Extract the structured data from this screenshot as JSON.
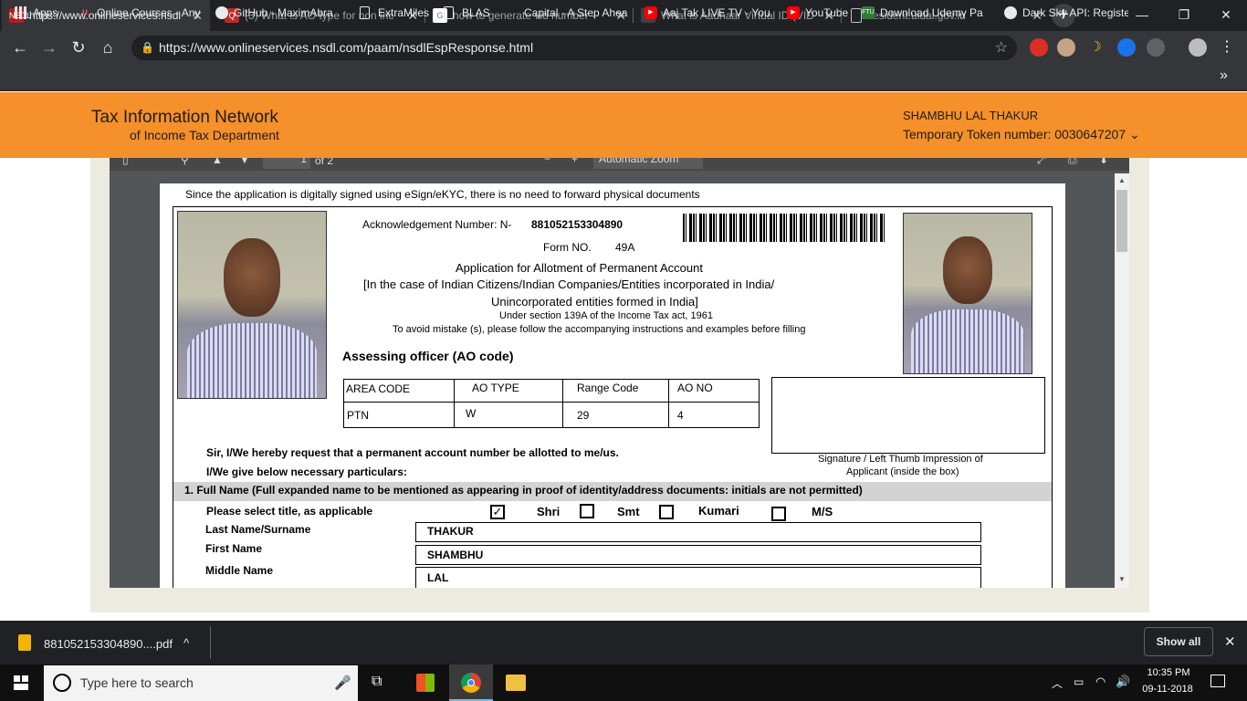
{
  "browser": {
    "tabs": [
      {
        "label": "https://www.onlineservices.nsdl",
        "favicon": "nsdl-icon",
        "favicon_text": "NSDL",
        "active": true
      },
      {
        "label": "(3) What is AO type for non inc",
        "favicon": "quora-icon",
        "favicon_text": "Q"
      },
      {
        "label": "how to generate vid number - ",
        "favicon": "google-icon",
        "favicon_text": "G"
      },
      {
        "label": "What is Aadhaar Virtual ID (VID",
        "favicon": "globe-icon",
        "favicon_text": "◐"
      },
      {
        "label": "resident.uidai.gov.in",
        "favicon": "page-icon",
        "favicon_text": ""
      }
    ],
    "new_tab_glyph": "+",
    "close_glyph": "✕",
    "window_controls": [
      "—",
      "❐",
      "✕"
    ],
    "nav": {
      "back": "←",
      "forward": "→",
      "reload": "↻",
      "home": "⌂"
    },
    "url": "https://www.onlineservices.nsdl.com/paam/nsdlEspResponse.html",
    "lock_glyph": "🔒",
    "star_glyph": "☆",
    "bookmarks": [
      {
        "label": "Apps",
        "icon": "apps-grid-icon"
      },
      {
        "label": "Online Courses - Any",
        "icon": "udemy-icon"
      },
      {
        "label": "GitHub - MaximAbra",
        "icon": "github-icon"
      },
      {
        "label": "ExtraMiles",
        "icon": "page-icon"
      },
      {
        "label": "BLAS",
        "icon": "page-icon"
      },
      {
        "label": "Capital - A Step Ahea",
        "icon": "none"
      },
      {
        "label": "Aaj Tak LIVE TV - You",
        "icon": "youtube-icon"
      },
      {
        "label": "YouTube",
        "icon": "youtube-icon"
      },
      {
        "label": "Download Udemy Pa",
        "icon": "ftu-icon"
      },
      {
        "label": "Dark Sky API: Registe",
        "icon": "darksky-icon"
      }
    ],
    "bookmarks_more": "»"
  },
  "site_header": {
    "brand_line1": "Tax Information Network",
    "brand_line2": "of Income Tax Department",
    "user_name": "SHAMBHU LAL THAKUR",
    "token_text": "Temporary Token number: 0030647207 ⌄",
    "colors": {
      "header_bg": "#f5902a"
    }
  },
  "pdf_viewer": {
    "page_field": "1",
    "page_count": "of 2",
    "zoom": "Automatic Zoom"
  },
  "form": {
    "notice": "Since the application is digitally signed using eSign/eKYC, there is no need to forward physical documents",
    "ack_label": "Acknowledgement Number: N-",
    "ack_number": "881052153304890",
    "form_no_label": "Form NO.",
    "form_no": "49A",
    "title": "Application for Allotment of Permanent Account",
    "subtitle1": "[In the case of Indian Citizens/Indian Companies/Entities incorporated in India/",
    "subtitle2": "Unincorporated entities formed in India]",
    "section_ref": "Under section 139A of the Income Tax act, 1961",
    "instruction": "To avoid mistake (s), please follow the accompanying instructions and examples before filling",
    "ao_heading": "Assessing officer (AO code)",
    "ao_table": {
      "headers": [
        "AREA CODE",
        "AO TYPE",
        "Range Code",
        "AO NO"
      ],
      "values": [
        "PTN",
        "W",
        "29",
        "4"
      ]
    },
    "signature_caption1": "Signature / Left Thumb Impression of",
    "signature_caption2": "Applicant (inside the box)",
    "request1": "Sir, I/We hereby request that a permanent account number be allotted to me/us.",
    "request2": "I/We give below necessary particulars:",
    "section1": "1.  Full Name (Full expanded name to be mentioned as appearing in proof of identity/address documents: initials are not permitted)",
    "title_prompt": "Please select title, as applicable",
    "titles": [
      {
        "label": "Shri",
        "checked": true
      },
      {
        "label": "Smt",
        "checked": false
      },
      {
        "label": "Kumari",
        "checked": false
      },
      {
        "label": "M/S",
        "checked": false
      }
    ],
    "check_glyph": "✓",
    "last_name_label": "Last  Name/Surname",
    "last_name": "THAKUR",
    "first_name_label": "First Name",
    "first_name": "SHAMBHU",
    "middle_name_label": "Middle Name",
    "middle_name": "LAL"
  },
  "downloads": {
    "file": "881052153304890....pdf",
    "show_all": "Show all",
    "caret": "^",
    "close": "✕"
  },
  "taskbar": {
    "search_placeholder": "Type here to search",
    "time": "10:35 PM",
    "date": "09-11-2018"
  }
}
